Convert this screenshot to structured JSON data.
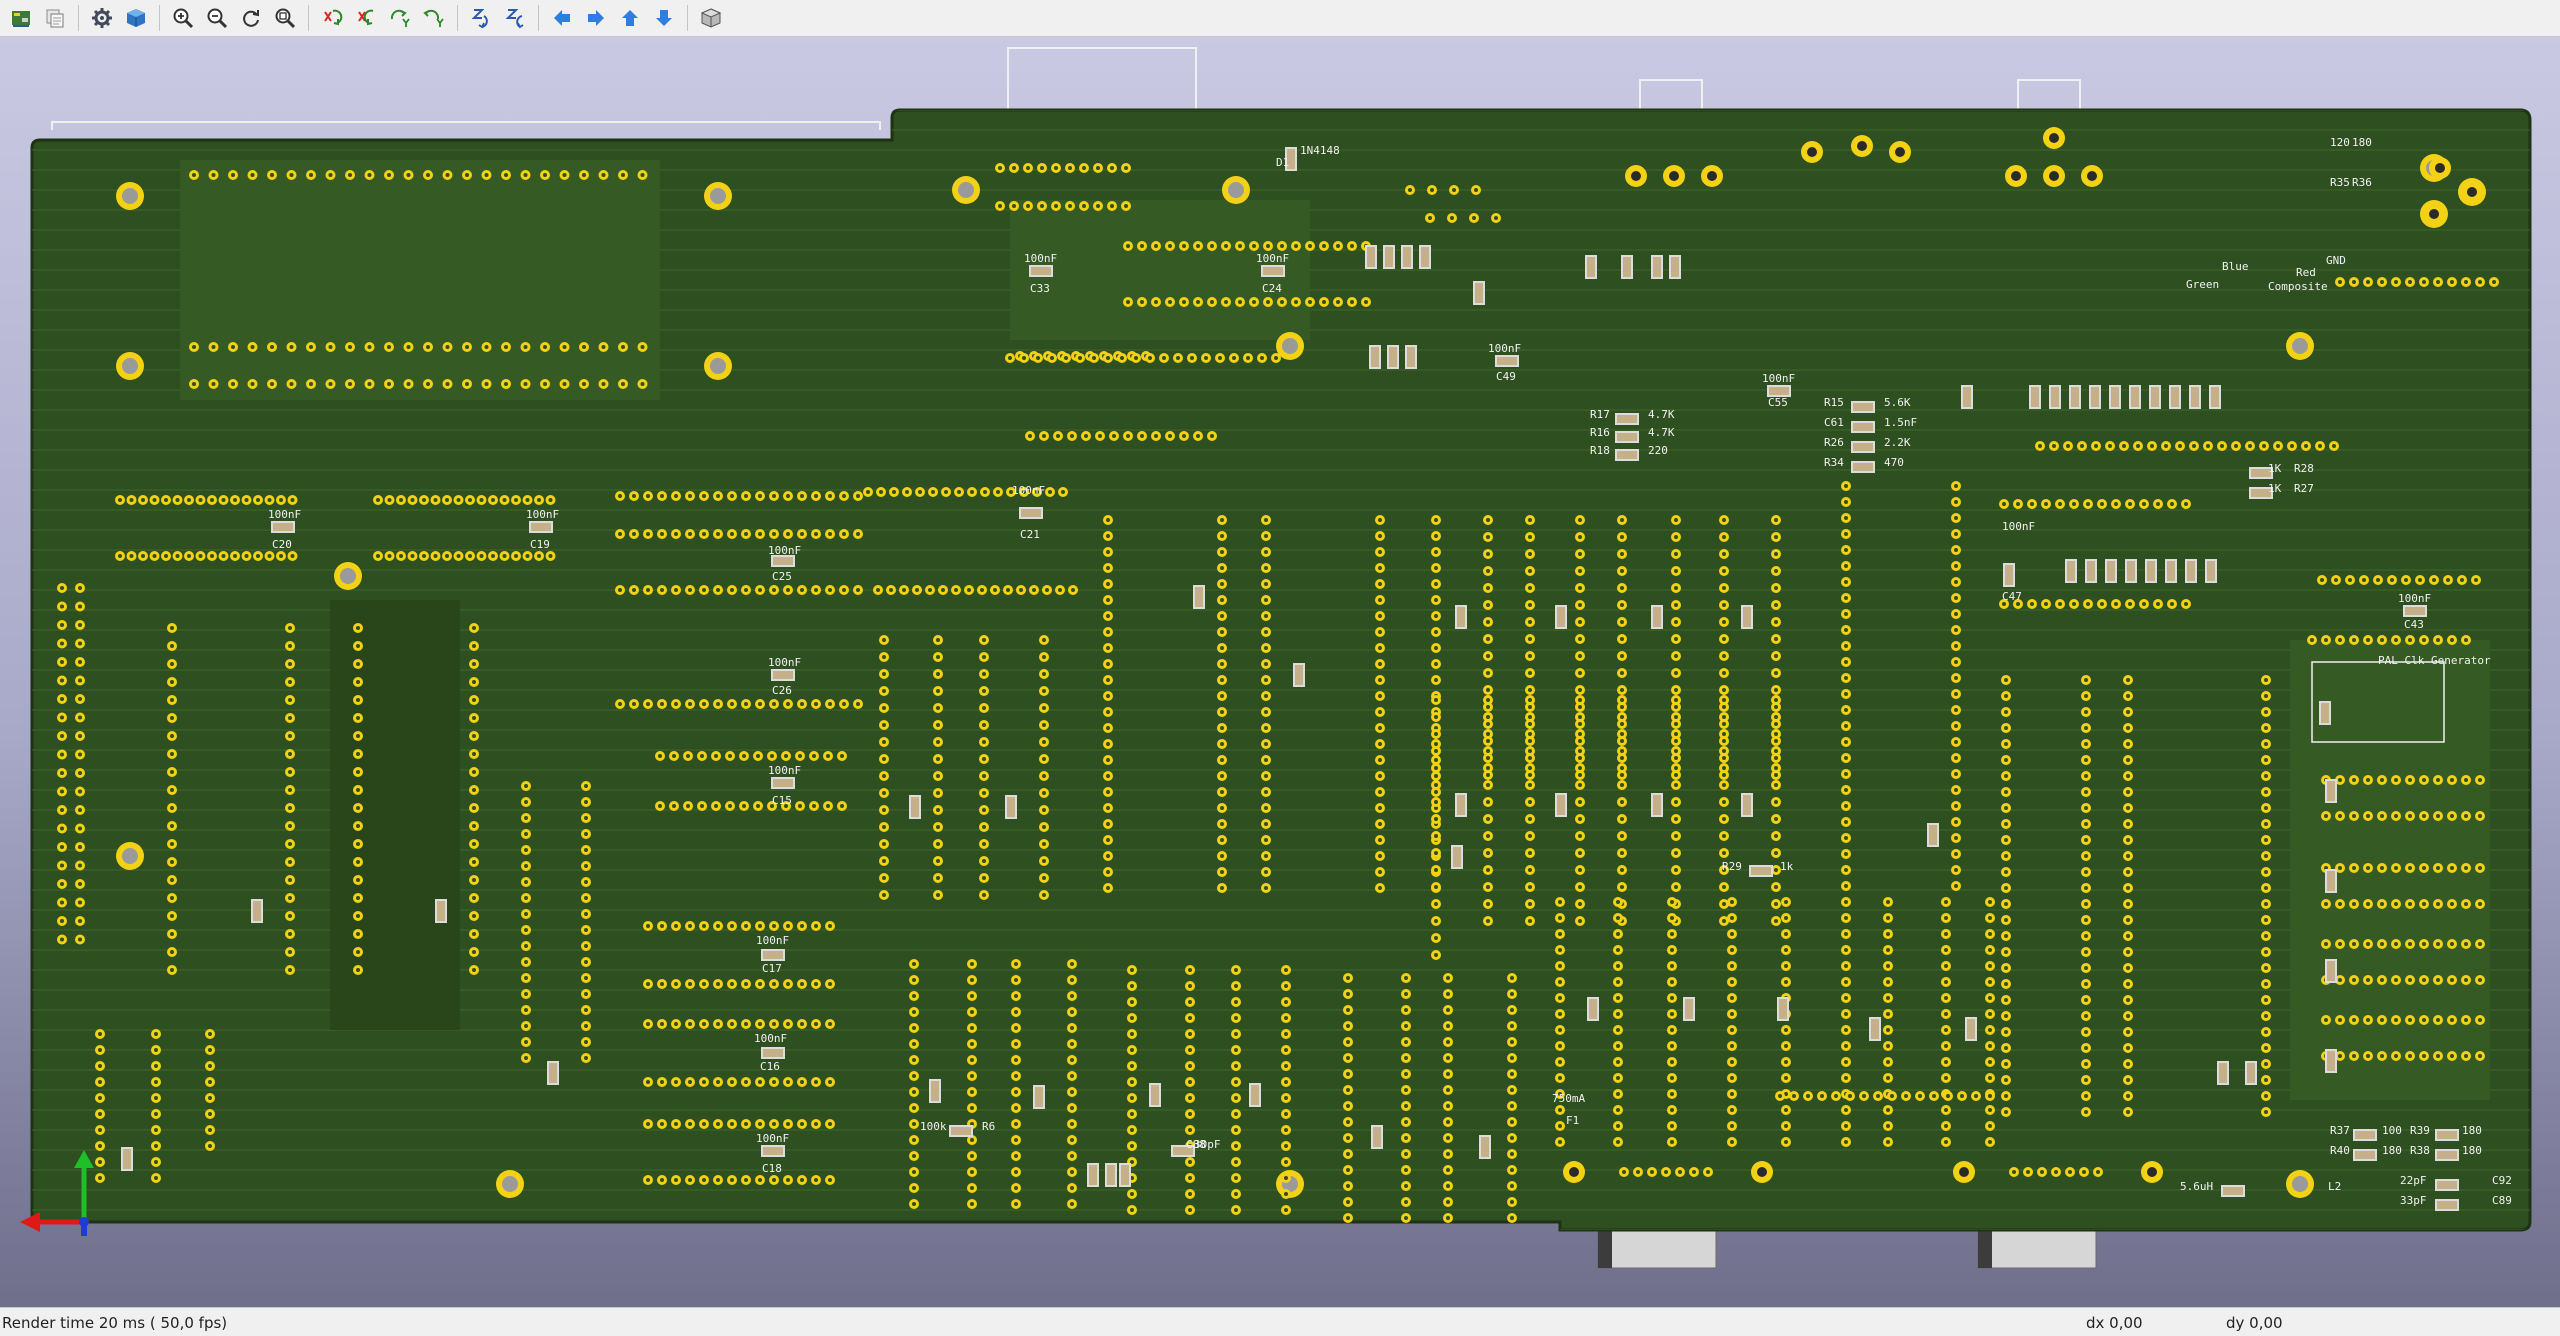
{
  "window": {
    "title": "3D Viewer"
  },
  "toolbar": {
    "buttons": [
      {
        "name": "reload-board-icon",
        "title": "Reload board"
      },
      {
        "name": "copy-image-icon",
        "title": "Copy 3D image to clipboard"
      },
      {
        "name": "separator"
      },
      {
        "name": "settings-gear-icon",
        "title": "3D display options"
      },
      {
        "name": "raytracing-cube-icon",
        "title": "Render options"
      },
      {
        "name": "separator"
      },
      {
        "name": "zoom-in-icon",
        "title": "Zoom in"
      },
      {
        "name": "zoom-out-icon",
        "title": "Zoom out"
      },
      {
        "name": "redraw-icon",
        "title": "Redraw"
      },
      {
        "name": "zoom-fit-icon",
        "title": "Fit on screen"
      },
      {
        "name": "separator"
      },
      {
        "name": "rotate-x-cw-icon",
        "title": "Rotate X clockwise"
      },
      {
        "name": "rotate-x-ccw-icon",
        "title": "Rotate X counterclockwise"
      },
      {
        "name": "rotate-y-cw-icon",
        "title": "Rotate Y clockwise"
      },
      {
        "name": "rotate-y-ccw-icon",
        "title": "Rotate Y counterclockwise"
      },
      {
        "name": "rotate-z-cw-icon",
        "title": "Rotate Z clockwise"
      },
      {
        "name": "rotate-z-ccw-icon",
        "title": "Rotate Z counterclockwise"
      },
      {
        "name": "separator"
      },
      {
        "name": "pan-left-icon",
        "title": "Pan left"
      },
      {
        "name": "pan-right-icon",
        "title": "Pan right"
      },
      {
        "name": "pan-up-icon",
        "title": "Pan up"
      },
      {
        "name": "pan-down-icon",
        "title": "Pan down"
      },
      {
        "name": "separator"
      },
      {
        "name": "orthographic-view-icon",
        "title": "Toggle orthographic projection"
      }
    ]
  },
  "board": {
    "colors": {
      "soldermask": "#2e4f1f",
      "copper_trace": "#436b2e",
      "pad": "#f3d215",
      "silk": "#f0f0f0",
      "hole": "#9a9a9a",
      "edge": "#1d3313"
    },
    "labels": [
      "100nF",
      "C20",
      "100nF",
      "C19",
      "100nF",
      "C25",
      "100nF",
      "C26",
      "100nF",
      "C15",
      "100nF",
      "C17",
      "100nF",
      "C16",
      "100nF",
      "C18",
      "100nF",
      "C33",
      "100nF",
      "C24",
      "100nF",
      "C21",
      "100nF",
      "C49",
      "100nF",
      "C55",
      "100nF",
      "C43",
      "100nF",
      "C47",
      "R15",
      "5.6K",
      "C61",
      "1.5nF",
      "R26",
      "2.2K",
      "R34",
      "470",
      "R17",
      "4.7K",
      "R16",
      "4.7K",
      "R18",
      "220",
      "R28",
      "1K",
      "R27",
      "1K",
      "R29",
      "1k",
      "R6",
      "100k",
      "R37",
      "100",
      "R40",
      "180",
      "R39",
      "180",
      "R38",
      "180",
      "C89",
      "33pF",
      "C92",
      "22pF",
      "C88",
      "30pF",
      "L2",
      "5.6uH",
      "F1",
      "750mA",
      "D1",
      "1N4148",
      "Green",
      "Blue",
      "Composite",
      "Red",
      "GND",
      "PAL Clk Generator",
      "R35",
      "R36",
      "120",
      "180"
    ]
  },
  "status": {
    "render_time": "Render time 20 ms ( 50,0 fps)",
    "dx": "dx 0,00",
    "dy": "dy 0,00"
  }
}
